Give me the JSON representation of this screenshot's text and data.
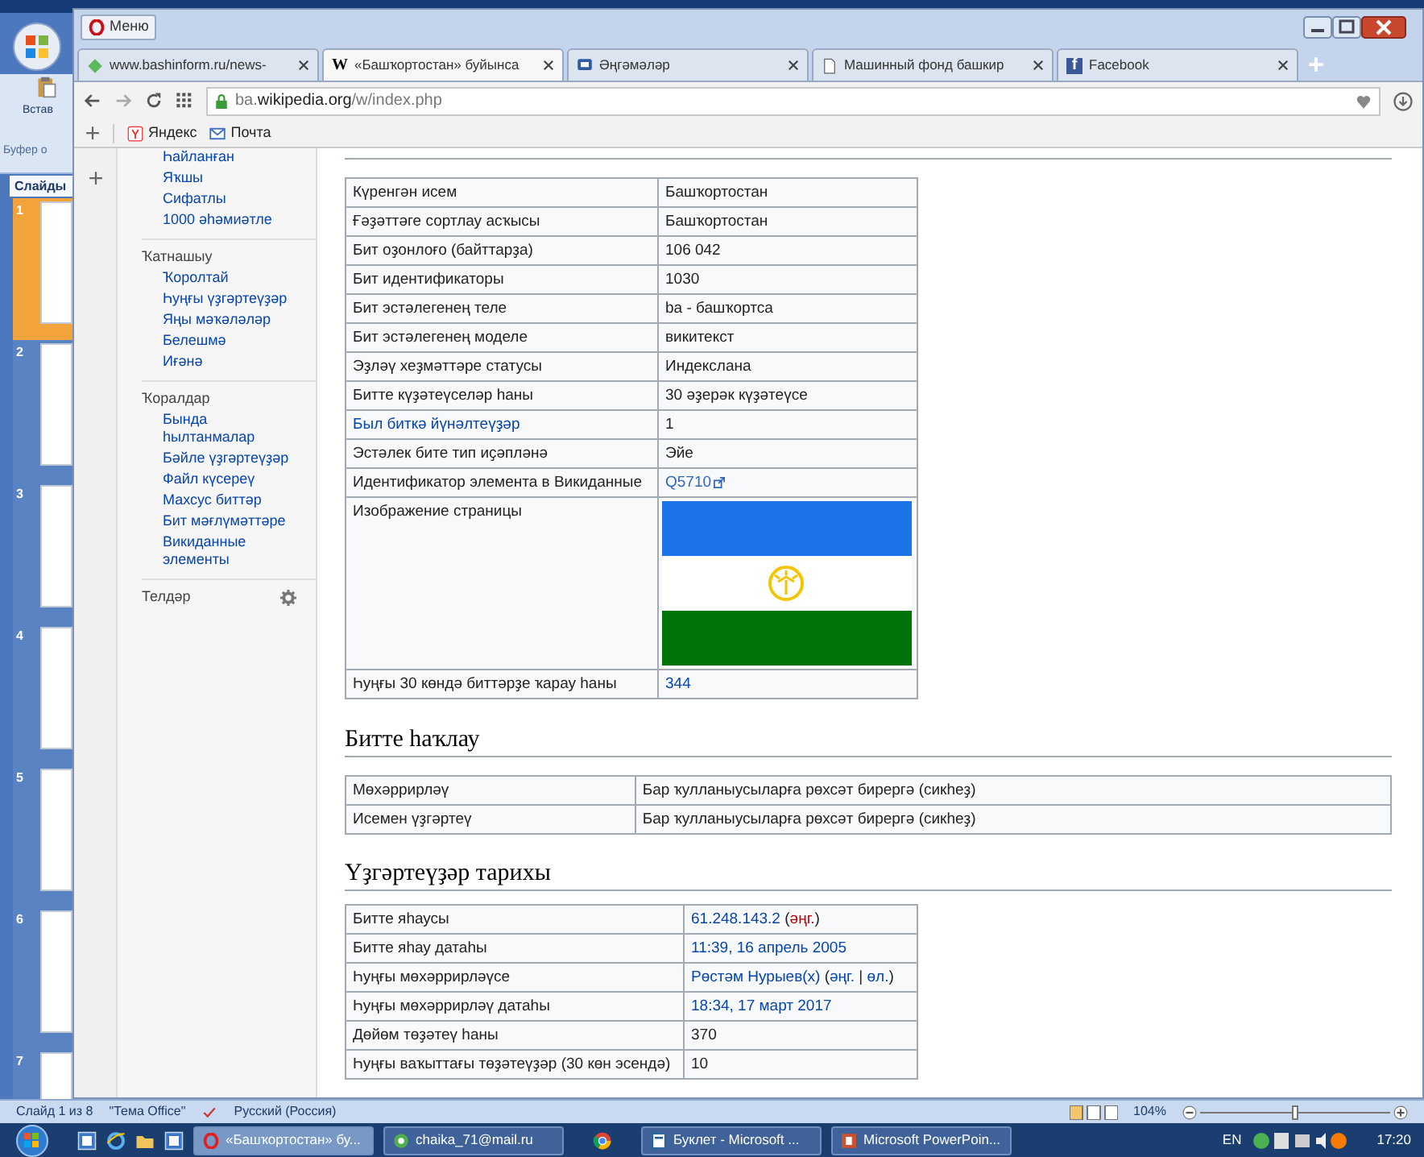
{
  "powerpoint": {
    "ribbon_button": "Встав",
    "ribbon_group": "Буфер о",
    "slides_tab": "Слайды",
    "slides": [
      {
        "number": "1",
        "selected": true
      },
      {
        "number": "2",
        "selected": false
      },
      {
        "number": "3",
        "selected": false
      },
      {
        "number": "4",
        "selected": false
      },
      {
        "number": "5",
        "selected": false
      },
      {
        "number": "6",
        "selected": false
      },
      {
        "number": "7",
        "selected": false
      }
    ],
    "status_bar": {
      "slide": "Слайд 1 из 8",
      "theme": "\"Тема Office\"",
      "language": "Русский (Россия)",
      "zoom": "104%",
      "zoom_slider": {
        "level": 0.5
      }
    }
  },
  "browser": {
    "menu": "Меню",
    "tabs": [
      {
        "title": "www.bashinform.ru/news-",
        "kind": "diamond",
        "selected": false
      },
      {
        "title": "«Башҡортостан» буйынса",
        "kind": "letter",
        "letter": "W",
        "selected": true
      },
      {
        "title": "Әңгәмәләр",
        "kind": "chat",
        "selected": false
      },
      {
        "title": "Машинный фонд башкир",
        "kind": "page",
        "selected": false
      },
      {
        "title": "Facebook",
        "kind": "letter",
        "letter": "f",
        "selected": false
      }
    ],
    "address": {
      "prefix": "ba.",
      "domain": "wikipedia.org",
      "path": "/w/index.php"
    },
    "bookmarks": [
      "Яндекс",
      "Почта"
    ]
  },
  "sidebar": {
    "top_items": [
      "Һайланған",
      "Яҡшы",
      "Сифатлы",
      "1000 әһәмиәтле"
    ],
    "groups": [
      {
        "title": "Ҡатнашыу",
        "items": [
          "Ҡоролтай",
          "Һуңғы үҙгәртеүҙәр",
          "Яңы мәҡәләләр",
          "Белешмә",
          "Иғәнә"
        ]
      },
      {
        "title": "Ҡоралдар",
        "items": [
          "Бында һылтанмалар",
          "Бәйле үҙгәртеүҙәр",
          "Файл күсереү",
          "Махсус биттәр",
          "Бит мәғлүмәттәре",
          "Викиданные элементы"
        ]
      }
    ],
    "languages": "Телдәр"
  },
  "info_table": [
    {
      "kind": "text",
      "label": "Күренгән исем",
      "label_link": false,
      "value": [
        {
          "text": "Башҡортостан",
          "kind": "plain"
        }
      ]
    },
    {
      "kind": "text",
      "label": "Ғәҙәттәге сортлау асҡысы",
      "label_link": false,
      "value": [
        {
          "text": "Башҡортостан",
          "kind": "plain"
        }
      ]
    },
    {
      "kind": "text",
      "label": "Бит оҙонлоғо (байттарҙа)",
      "label_link": false,
      "value": [
        {
          "text": "106 042",
          "kind": "plain"
        }
      ]
    },
    {
      "kind": "text",
      "label": "Бит идентификаторы",
      "label_link": false,
      "value": [
        {
          "text": "1030",
          "kind": "plain"
        }
      ]
    },
    {
      "kind": "text",
      "label": "Бит эстәлегенең теле",
      "label_link": false,
      "value": [
        {
          "text": "ba - башҡортса",
          "kind": "plain"
        }
      ]
    },
    {
      "kind": "text",
      "label": "Бит эстәлегенең моделе",
      "label_link": false,
      "value": [
        {
          "text": "викитекст",
          "kind": "plain"
        }
      ]
    },
    {
      "kind": "text",
      "label": "Эҙләү хеҙмәттәре статусы",
      "label_link": false,
      "value": [
        {
          "text": "Индекслана",
          "kind": "plain"
        }
      ]
    },
    {
      "kind": "text",
      "label": "Битте күҙәтеүселәр һаны",
      "label_link": false,
      "value": [
        {
          "text": "30 әҙерәк күҙәтеүсе",
          "kind": "plain"
        }
      ]
    },
    {
      "kind": "text",
      "label": "Был биткә йүнәлтеүҙәр",
      "label_link": true,
      "value": [
        {
          "text": "1",
          "kind": "plain"
        }
      ]
    },
    {
      "kind": "text",
      "label": "Эстәлек бите тип иҫәпләнә",
      "label_link": false,
      "value": [
        {
          "text": "Эйе",
          "kind": "plain"
        }
      ]
    },
    {
      "kind": "text",
      "label": "Идентификатор элемента в Викиданные",
      "label_link": false,
      "value": [
        {
          "text": "Q5710",
          "kind": "external"
        }
      ]
    },
    {
      "kind": "image",
      "label": "Изображение страницы",
      "label_link": false
    },
    {
      "kind": "text",
      "label": "Һуңғы 30 көндә биттәрҙе ҡарау һаны",
      "label_link": false,
      "value": [
        {
          "text": "344",
          "kind": "link"
        }
      ]
    }
  ],
  "protection": {
    "heading": "Битте һаҡлау",
    "rows": [
      {
        "label": "Мөхәррирләү",
        "value": "Бар ҡулланыусыларға рөхсәт бирергә (сикһеҙ)"
      },
      {
        "label": "Исемен үҙгәртеү",
        "value": "Бар ҡулланыусыларға рөхсәт бирергә (сикһеҙ)"
      }
    ]
  },
  "history": {
    "heading": "Үҙгәртеүҙәр тарихы",
    "rows": [
      {
        "label": "Битте яһаусы",
        "value": [
          {
            "text": "61.248.143.2",
            "kind": "link"
          },
          {
            "text": " (",
            "kind": "plain"
          },
          {
            "text": "әңг.",
            "kind": "redlink"
          },
          {
            "text": ")",
            "kind": "plain"
          }
        ]
      },
      {
        "label": "Битте яһау датаһы",
        "value": [
          {
            "text": "11:39, 16 апрель 2005",
            "kind": "link"
          }
        ]
      },
      {
        "label": "Һуңғы мөхәррирләүсе",
        "value": [
          {
            "text": "Рөстәм Нурыев(х)",
            "kind": "link"
          },
          {
            "text": " (",
            "kind": "plain"
          },
          {
            "text": "әңг.",
            "kind": "link"
          },
          {
            "text": " | ",
            "kind": "plain"
          },
          {
            "text": "өл.",
            "kind": "link"
          },
          {
            "text": ")",
            "kind": "plain"
          }
        ]
      },
      {
        "label": "Һуңғы мөхәррирләү датаһы",
        "value": [
          {
            "text": "18:34, 17 март 2017",
            "kind": "link"
          }
        ]
      },
      {
        "label": "Дөйөм төҙәтеү һаны",
        "value": [
          {
            "text": "370",
            "kind": "plain"
          }
        ]
      },
      {
        "label": "Һуңғы ваҡыттағы төҙәтеүҙәр (30 көн эсендә)",
        "value": [
          {
            "text": "10",
            "kind": "plain"
          }
        ]
      }
    ]
  },
  "taskbar": {
    "tasks": [
      {
        "title": "«Башҡортостан» бу...",
        "kind": "opera",
        "selected": true
      },
      {
        "title": "chaika_71@mail.ru",
        "kind": "mail",
        "selected": false
      },
      {
        "title": "Буклет - Microsoft ...",
        "kind": "publisher",
        "selected": false
      },
      {
        "title": "Microsoft PowerPoin...",
        "kind": "powerpoint",
        "selected": false
      }
    ],
    "language": "EN",
    "time": "17:20"
  }
}
